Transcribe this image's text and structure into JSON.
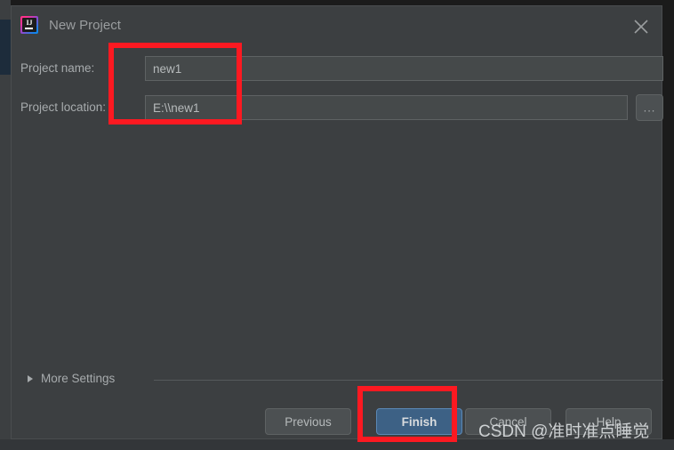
{
  "window": {
    "title": "New Project",
    "app_icon_name": "intellij-idea-icon",
    "app_icon_text": "IJ",
    "close_label": "×"
  },
  "form": {
    "name_label": "Project name:",
    "name_value": "new1",
    "location_label": "Project location:",
    "location_value": "E:\\\\new1",
    "browse_label": "..."
  },
  "more_settings": {
    "label": "More Settings",
    "expanded": false
  },
  "footer": {
    "previous": "Previous",
    "finish": "Finish",
    "cancel": "Cancel",
    "help": "Help"
  },
  "annotations": {
    "color": "#fc1921",
    "boxes": [
      "project-fields",
      "finish-button"
    ]
  },
  "watermark": {
    "text": "CSDN @准时准点睡觉"
  },
  "colors": {
    "dialog_bg": "#3c3f41",
    "input_bg": "#45494a",
    "button_bg": "#4c5052",
    "primary_button_bg": "#3d6185",
    "text": "#a7abad",
    "annotation_red": "#fc1921"
  }
}
